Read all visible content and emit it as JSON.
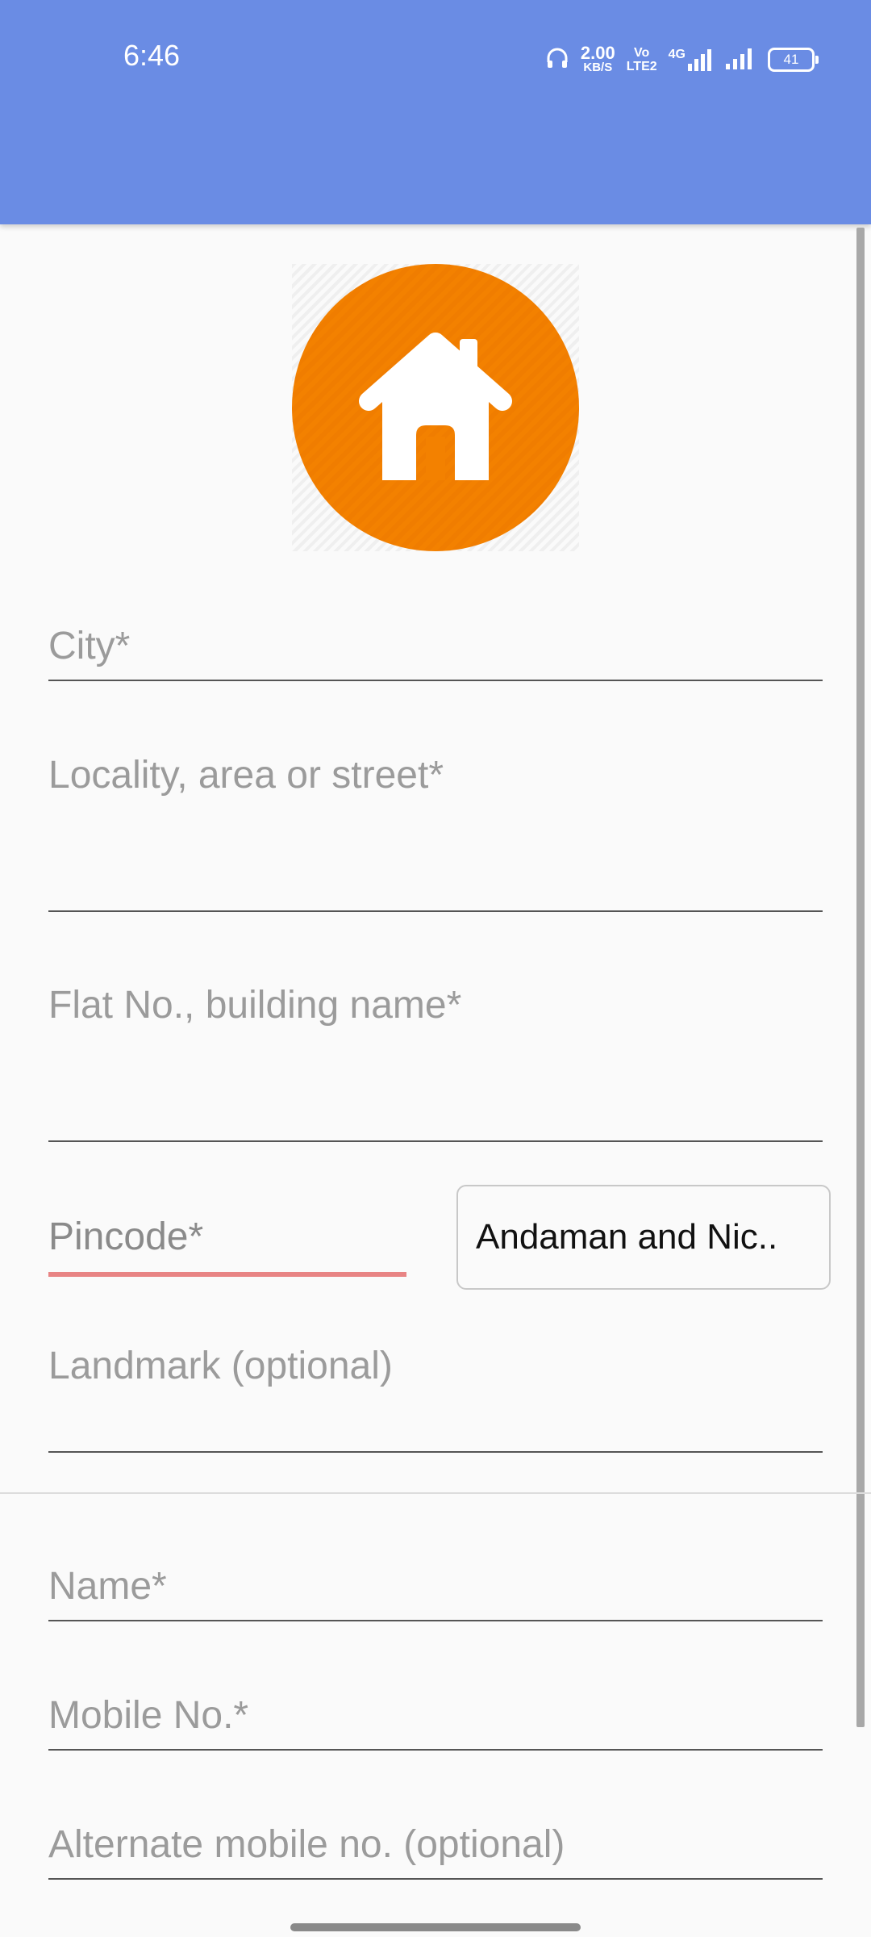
{
  "status_bar": {
    "time": "6:46",
    "speed_value": "2.00",
    "speed_unit": "KB/S",
    "volte_top": "Vo",
    "volte_bottom": "LTE2",
    "network": "4G",
    "battery": "41"
  },
  "form": {
    "city_placeholder": "City*",
    "locality_placeholder": "Locality, area or street*",
    "flat_placeholder": "Flat No., building name*",
    "pincode_placeholder": "Pincode*",
    "state_value": "Andaman and Nic..",
    "landmark_placeholder": "Landmark (optional)",
    "name_placeholder": "Name*",
    "mobile_placeholder": "Mobile No.*",
    "alt_mobile_placeholder": "Alternate mobile no. (optional)"
  },
  "icons": {
    "logo": "home-icon",
    "headphones": "headphones-icon",
    "signal": "signal-icon",
    "battery": "battery-icon"
  },
  "colors": {
    "app_bar": "#6a8ce4",
    "logo_orange": "#f38100",
    "error_underline": "#e88484"
  }
}
